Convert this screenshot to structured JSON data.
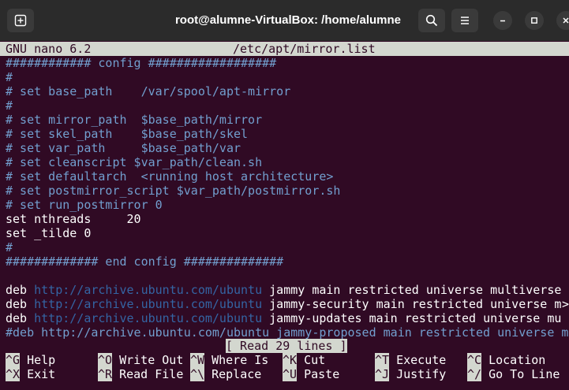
{
  "window": {
    "title": "root@alumne-VirtualBox: /home/alumne"
  },
  "icons": {
    "new_tab": "new-tab-icon",
    "search": "search-icon",
    "menu": "hamburger-menu-icon",
    "minimize": "minimize-icon",
    "maximize": "maximize-icon",
    "close": "close-icon"
  },
  "nano": {
    "version": "GNU nano 6.2",
    "filename": "/etc/apt/mirror.list"
  },
  "file_lines": [
    {
      "segs": [
        {
          "t": "############ config ##################",
          "c": "cmt"
        }
      ]
    },
    {
      "segs": [
        {
          "t": "#",
          "c": "cmt"
        }
      ]
    },
    {
      "segs": [
        {
          "t": "# set base_path    /var/spool/apt-mirror",
          "c": "cmt"
        }
      ]
    },
    {
      "segs": [
        {
          "t": "#",
          "c": "cmt"
        }
      ]
    },
    {
      "segs": [
        {
          "t": "# set mirror_path  $base_path/mirror",
          "c": "cmt"
        }
      ]
    },
    {
      "segs": [
        {
          "t": "# set skel_path    $base_path/skel",
          "c": "cmt"
        }
      ]
    },
    {
      "segs": [
        {
          "t": "# set var_path     $base_path/var",
          "c": "cmt"
        }
      ]
    },
    {
      "segs": [
        {
          "t": "# set cleanscript $var_path/clean.sh",
          "c": "cmt"
        }
      ]
    },
    {
      "segs": [
        {
          "t": "# set defaultarch  <running host architecture>",
          "c": "cmt"
        }
      ]
    },
    {
      "segs": [
        {
          "t": "# set postmirror_script $var_path/postmirror.sh",
          "c": "cmt"
        }
      ]
    },
    {
      "segs": [
        {
          "t": "# set run_postmirror 0",
          "c": "cmt"
        }
      ]
    },
    {
      "segs": [
        {
          "t": "set nthreads     20",
          "c": "txt"
        }
      ]
    },
    {
      "segs": [
        {
          "t": "set _tilde 0",
          "c": "txt"
        }
      ]
    },
    {
      "segs": [
        {
          "t": "#",
          "c": "cmt"
        }
      ]
    },
    {
      "segs": [
        {
          "t": "############# end config ##############",
          "c": "cmt"
        }
      ]
    },
    {
      "segs": []
    },
    {
      "segs": [
        {
          "t": "deb ",
          "c": "txt"
        },
        {
          "t": "http://archive.ubuntu.com/ubuntu",
          "c": "url"
        },
        {
          "t": " jammy main restricted universe multiverse",
          "c": "txt"
        }
      ]
    },
    {
      "segs": [
        {
          "t": "deb ",
          "c": "txt"
        },
        {
          "t": "http://archive.ubuntu.com/ubuntu",
          "c": "url"
        },
        {
          "t": " jammy-security main restricted universe mu",
          "c": "txt"
        }
      ]
    },
    {
      "segs": [
        {
          "t": "deb ",
          "c": "txt"
        },
        {
          "t": "http://archive.ubuntu.com/ubuntu",
          "c": "url"
        },
        {
          "t": " jammy-updates main restricted universe mu",
          "c": "txt"
        }
      ]
    },
    {
      "segs": [
        {
          "t": "#deb http://archive.ubuntu.com/ubuntu jammy-proposed main restricted universe m",
          "c": "cmt"
        }
      ]
    }
  ],
  "overflow_marker": ">",
  "status_message": "[ Read 29 lines ]",
  "shortcuts": [
    {
      "key": "^G",
      "label": "Help"
    },
    {
      "key": "^O",
      "label": "Write Out"
    },
    {
      "key": "^W",
      "label": "Where Is"
    },
    {
      "key": "^K",
      "label": "Cut"
    },
    {
      "key": "^T",
      "label": "Execute"
    },
    {
      "key": "^C",
      "label": "Location"
    },
    {
      "key": "^X",
      "label": "Exit"
    },
    {
      "key": "^R",
      "label": "Read File"
    },
    {
      "key": "^\\",
      "label": "Replace"
    },
    {
      "key": "^U",
      "label": "Paste"
    },
    {
      "key": "^J",
      "label": "Justify"
    },
    {
      "key": "^/",
      "label": "Go To Line"
    }
  ],
  "colors": {
    "background": "#300a24",
    "comment": "#729fcf",
    "url": "#3465a4",
    "text": "#ffffff",
    "bar": "#d3d7cf"
  }
}
